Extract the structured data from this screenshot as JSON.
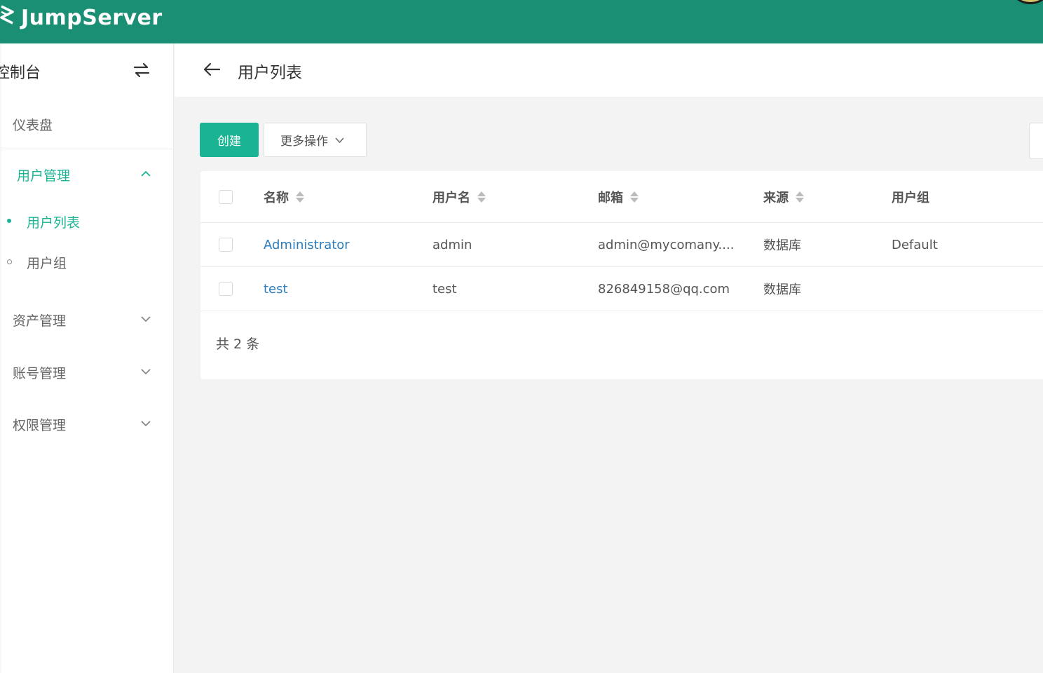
{
  "app": {
    "brand": "JumpServer",
    "accent": "#1ab394",
    "topbar_color": "#1b8f74"
  },
  "sidebar": {
    "title": "控制台",
    "items": [
      {
        "label": "仪表盘"
      },
      {
        "label": "用户管理",
        "expanded": true,
        "active": true,
        "children": [
          {
            "label": "用户列表",
            "active": true
          },
          {
            "label": "用户组"
          }
        ]
      },
      {
        "label": "资产管理"
      },
      {
        "label": "账号管理"
      },
      {
        "label": "权限管理"
      }
    ]
  },
  "page": {
    "title": "用户列表"
  },
  "toolbar": {
    "create_label": "创建",
    "more_label": "更多操作"
  },
  "table": {
    "columns": [
      "名称",
      "用户名",
      "邮箱",
      "来源",
      "用户组"
    ],
    "rows": [
      {
        "name": "Administrator",
        "username": "admin",
        "email": "admin@mycomany....",
        "source": "数据库",
        "group": "Default"
      },
      {
        "name": "test",
        "username": "test",
        "email": "826849158@qq.com",
        "source": "数据库",
        "group": ""
      }
    ],
    "total_label": "共 2 条"
  }
}
